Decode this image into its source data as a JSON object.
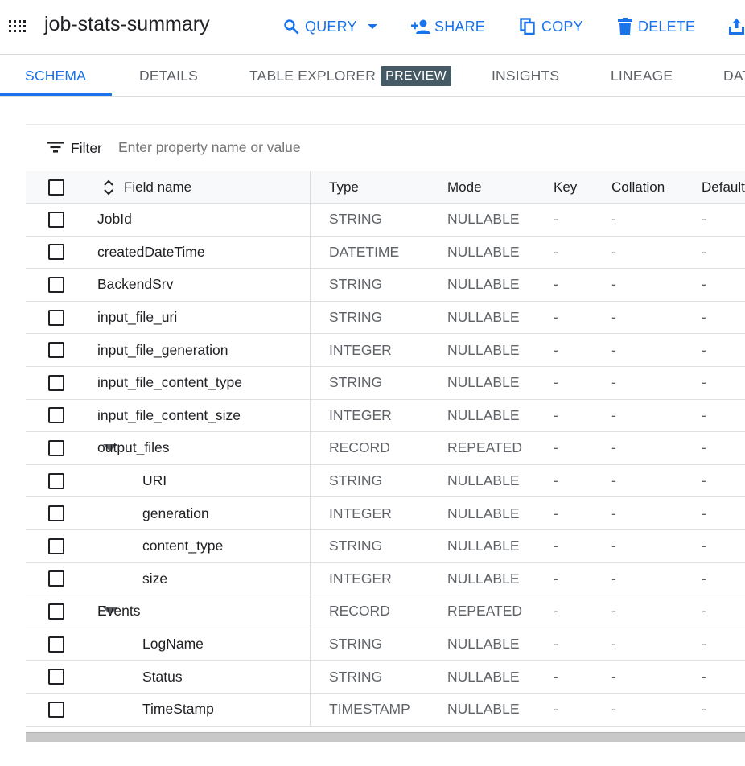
{
  "header": {
    "title": "job-stats-summary",
    "actions": {
      "query": "QUERY",
      "share": "SHARE",
      "copy": "COPY",
      "delete": "DELETE"
    }
  },
  "tabs": {
    "schema": "SCHEMA",
    "details": "DETAILS",
    "table_explorer": "TABLE EXPLORER",
    "preview_badge": "PREVIEW",
    "insights": "INSIGHTS",
    "lineage": "LINEAGE",
    "data": "DAT"
  },
  "filter": {
    "label": "Filter",
    "placeholder": "Enter property name or value"
  },
  "columns": {
    "field_name": "Field name",
    "type": "Type",
    "mode": "Mode",
    "key": "Key",
    "collation": "Collation",
    "default": "Default"
  },
  "rows": [
    {
      "name": "JobId",
      "type": "STRING",
      "mode": "NULLABLE",
      "key": "-",
      "collation": "-",
      "default": "-"
    },
    {
      "name": "createdDateTime",
      "type": "DATETIME",
      "mode": "NULLABLE",
      "key": "-",
      "collation": "-",
      "default": "-"
    },
    {
      "name": "BackendSrv",
      "type": "STRING",
      "mode": "NULLABLE",
      "key": "-",
      "collation": "-",
      "default": "-"
    },
    {
      "name": "input_file_uri",
      "type": "STRING",
      "mode": "NULLABLE",
      "key": "-",
      "collation": "-",
      "default": "-"
    },
    {
      "name": "input_file_generation",
      "type": "INTEGER",
      "mode": "NULLABLE",
      "key": "-",
      "collation": "-",
      "default": "-"
    },
    {
      "name": "input_file_content_type",
      "type": "STRING",
      "mode": "NULLABLE",
      "key": "-",
      "collation": "-",
      "default": "-"
    },
    {
      "name": "input_file_content_size",
      "type": "INTEGER",
      "mode": "NULLABLE",
      "key": "-",
      "collation": "-",
      "default": "-"
    },
    {
      "name": "output_files",
      "type": "RECORD",
      "mode": "REPEATED",
      "key": "-",
      "collation": "-",
      "default": "-"
    },
    {
      "name": "URI",
      "type": "STRING",
      "mode": "NULLABLE",
      "key": "-",
      "collation": "-",
      "default": "-"
    },
    {
      "name": "generation",
      "type": "INTEGER",
      "mode": "NULLABLE",
      "key": "-",
      "collation": "-",
      "default": "-"
    },
    {
      "name": "content_type",
      "type": "STRING",
      "mode": "NULLABLE",
      "key": "-",
      "collation": "-",
      "default": "-"
    },
    {
      "name": "size",
      "type": "INTEGER",
      "mode": "NULLABLE",
      "key": "-",
      "collation": "-",
      "default": "-"
    },
    {
      "name": "Events",
      "type": "RECORD",
      "mode": "REPEATED",
      "key": "-",
      "collation": "-",
      "default": "-"
    },
    {
      "name": "LogName",
      "type": "STRING",
      "mode": "NULLABLE",
      "key": "-",
      "collation": "-",
      "default": "-"
    },
    {
      "name": "Status",
      "type": "STRING",
      "mode": "NULLABLE",
      "key": "-",
      "collation": "-",
      "default": "-"
    },
    {
      "name": "TimeStamp",
      "type": "TIMESTAMP",
      "mode": "NULLABLE",
      "key": "-",
      "collation": "-",
      "default": "-"
    }
  ],
  "icons": {
    "apps": "apps-grid-icon",
    "query": "search-icon",
    "query_menu": "dropdown-arrow-icon",
    "share": "person-add-icon",
    "copy": "copy-icon",
    "delete": "trash-icon",
    "export": "export-icon",
    "filter": "filter-icon",
    "sort": "sort-icon",
    "expand": "expand-arrow-icon"
  },
  "colors": {
    "accent": "#1a73e8",
    "badge": "#455a64",
    "muted_text": "#5f6368"
  }
}
